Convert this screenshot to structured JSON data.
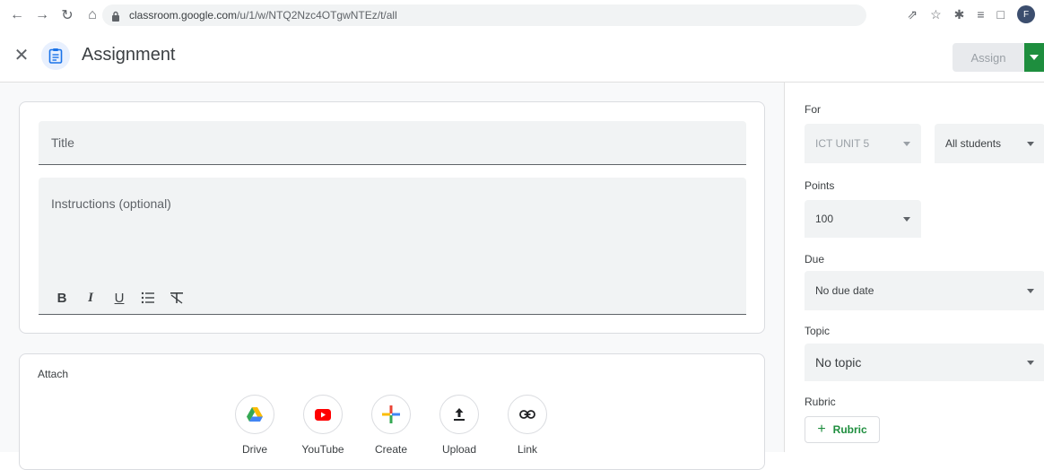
{
  "browser": {
    "url_host": "classroom.google.com",
    "url_path": "/u/1/w/NTQ2Nzc4OTgwNTEz/t/all",
    "profile_initial": "F"
  },
  "header": {
    "title": "Assignment",
    "assign_label": "Assign"
  },
  "form": {
    "title_placeholder": "Title",
    "instructions_placeholder": "Instructions (optional)",
    "toolbar": [
      "B",
      "I",
      "U",
      "≡",
      "T̶"
    ]
  },
  "attach": {
    "label": "Attach",
    "items": [
      {
        "label": "Drive",
        "icon": "drive-icon"
      },
      {
        "label": "YouTube",
        "icon": "youtube-icon"
      },
      {
        "label": "Create",
        "icon": "create-plus-icon"
      },
      {
        "label": "Upload",
        "icon": "upload-icon"
      },
      {
        "label": "Link",
        "icon": "link-icon"
      }
    ]
  },
  "side": {
    "for_label": "For",
    "class_value": "ICT UNIT 5",
    "students_value": "All students",
    "points_label": "Points",
    "points_value": "100",
    "due_label": "Due",
    "due_value": "No due date",
    "topic_label": "Topic",
    "topic_value": "No topic",
    "rubric_label": "Rubric",
    "rubric_button": "Rubric"
  },
  "colors": {
    "accent_green": "#1e8e3e",
    "field_bg": "#f1f3f4"
  }
}
